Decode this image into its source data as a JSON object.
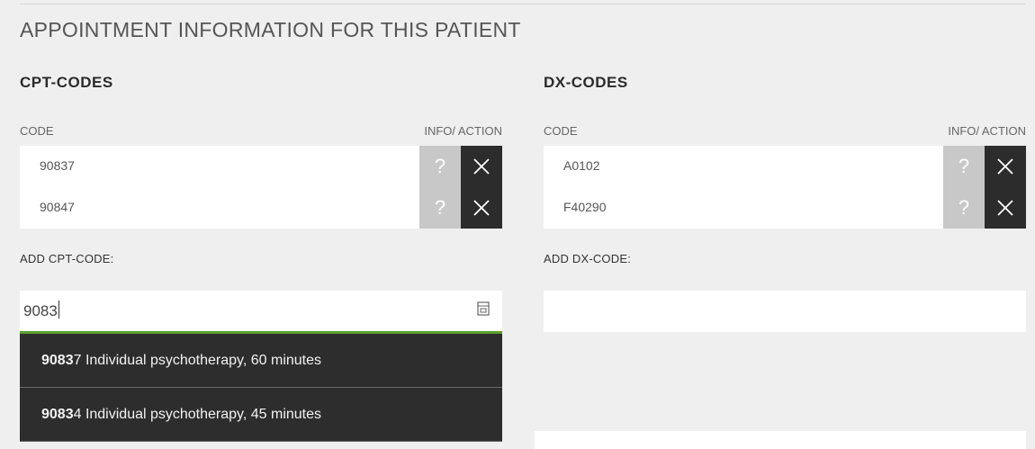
{
  "section": {
    "title": "APPOINTMENT INFORMATION FOR THIS PATIENT"
  },
  "cpt": {
    "title": "CPT-CODES",
    "col_code": "CODE",
    "col_info": "INFO/ ACTION",
    "rows": [
      {
        "code": "90837",
        "info": "?",
        "action_icon": "close-icon"
      },
      {
        "code": "90847",
        "info": "?",
        "action_icon": "close-icon"
      }
    ],
    "add_label": "ADD CPT-CODE:",
    "input_value": "9083",
    "input_icon": "calendar-icon",
    "suggestions": [
      {
        "match": "9083",
        "rest": "7 Individual psychotherapy, 60 minutes"
      },
      {
        "match": "9083",
        "rest": "4 Individual psychotherapy, 45 minutes"
      }
    ]
  },
  "dx": {
    "title": "DX-CODES",
    "col_code": "CODE",
    "col_info": "INFO/ ACTION",
    "rows": [
      {
        "code": "A0102",
        "info": "?",
        "action_icon": "close-icon"
      },
      {
        "code": "F40290",
        "info": "?",
        "action_icon": "close-icon"
      }
    ],
    "add_label": "ADD DX-CODE:",
    "input_value": ""
  },
  "colors": {
    "background": "#efefef",
    "dark_button": "#2c2c2c",
    "info_button": "#c8c8c8",
    "focus_underline": "#5aa02c"
  }
}
